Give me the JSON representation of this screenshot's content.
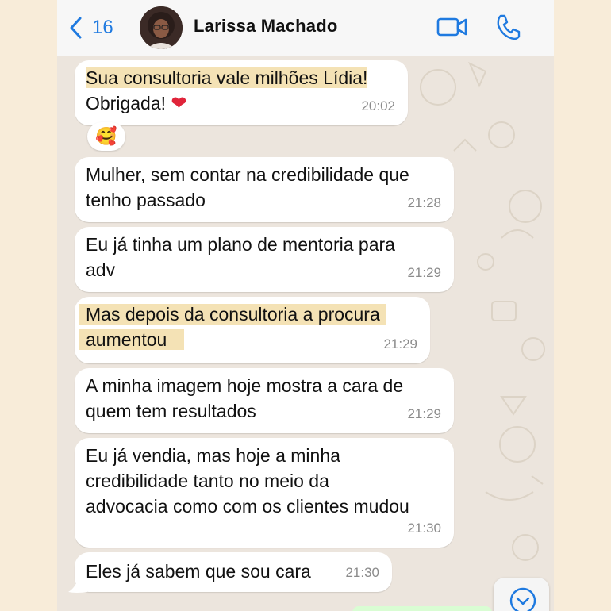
{
  "header": {
    "back_count": "16",
    "contact_name": "Larissa Machado"
  },
  "messages": [
    {
      "lines": [
        "Sua consultoria vale milhões Lídia!",
        "Obrigada!"
      ],
      "heart": "❤",
      "time": "20:02"
    },
    {
      "lines": [
        "Mulher, sem contar na credibilidade que",
        "tenho passado"
      ],
      "time": "21:28"
    },
    {
      "lines": [
        "Eu já tinha um plano de mentoria para",
        "adv"
      ],
      "time": "21:29"
    },
    {
      "lines": [
        "Mas depois da consultoria a procura",
        "aumentou"
      ],
      "time": "21:29"
    },
    {
      "lines": [
        "A minha imagem hoje mostra a cara de",
        "quem tem resultados"
      ],
      "time": "21:29"
    },
    {
      "lines": [
        "Eu já vendia, mas hoje a minha",
        "credibilidade tanto no meio da",
        "advocacia como com os clientes mudou"
      ],
      "time": "21:30"
    },
    {
      "lines": [
        "Eles já sabem que sou cara"
      ],
      "time": "21:30"
    }
  ],
  "reaction": {
    "emoji": "🥰"
  },
  "colors": {
    "accent": "#1f7ae0",
    "highlight": "#f4e2b5",
    "bubble": "#ffffff",
    "chat_bg": "#ece5dd"
  },
  "icons": [
    "chevron-left-icon",
    "video-call-icon",
    "phone-call-icon",
    "scroll-down-icon"
  ]
}
